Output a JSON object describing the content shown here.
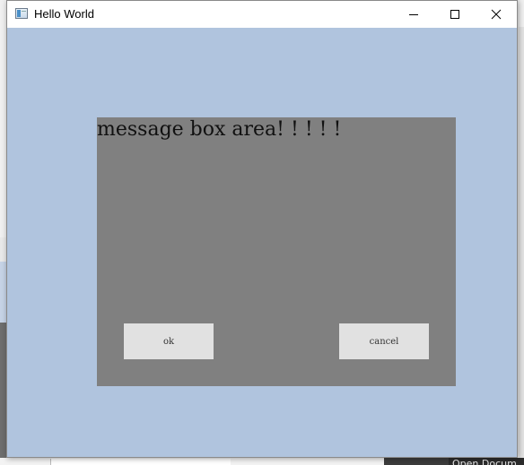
{
  "window": {
    "title": "Hello World",
    "icon": "app-window-icon",
    "controls": {
      "minimize_icon": "minimize-icon",
      "maximize_icon": "maximize-icon",
      "close_icon": "close-icon"
    },
    "client_background": "#b0c4de"
  },
  "message_box": {
    "text": "message box area! ! ! ! !",
    "background": "#808080",
    "ok_label": "ok",
    "cancel_label": "cancel",
    "button_background": "#e1e1e1"
  },
  "background_windows": {
    "taskbar_fragment_text": "Open Docum"
  }
}
